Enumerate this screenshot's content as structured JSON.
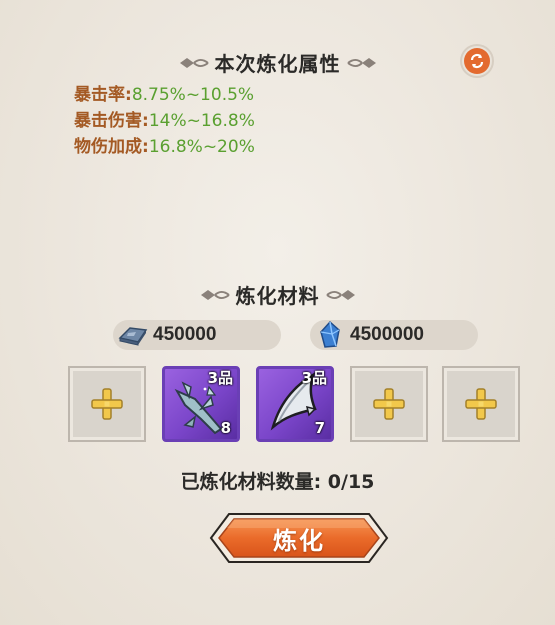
{
  "attributes_title": "本次炼化属性",
  "refresh_icon": "refresh-icon",
  "attributes": [
    {
      "label": "暴击率:",
      "value": "8.75%~10.5%"
    },
    {
      "label": "暴击伤害:",
      "value": "14%~16.8%"
    },
    {
      "label": "物伤加成:",
      "value": "16.8%~20%"
    }
  ],
  "materials_title": "炼化材料",
  "currencies": [
    {
      "icon": "silver-ingot-icon",
      "amount": "450000"
    },
    {
      "icon": "blue-crystal-icon",
      "amount": "4500000"
    }
  ],
  "slots": [
    {
      "type": "empty",
      "icon": "plus-icon"
    },
    {
      "type": "item",
      "icon": "bamboo-material-icon",
      "grade": "3品",
      "count": "8"
    },
    {
      "type": "item",
      "icon": "claw-material-icon",
      "grade": "3品",
      "count": "7"
    },
    {
      "type": "empty",
      "icon": "plus-icon"
    },
    {
      "type": "empty",
      "icon": "plus-icon"
    }
  ],
  "refined_count": "已炼化材料数量: 0/15",
  "refine_button": "炼化",
  "colors": {
    "attr_label": "#a45a24",
    "attr_value": "#5aa030",
    "accent_orange": "#e36a2f",
    "item_purple": "#7a45c9"
  }
}
